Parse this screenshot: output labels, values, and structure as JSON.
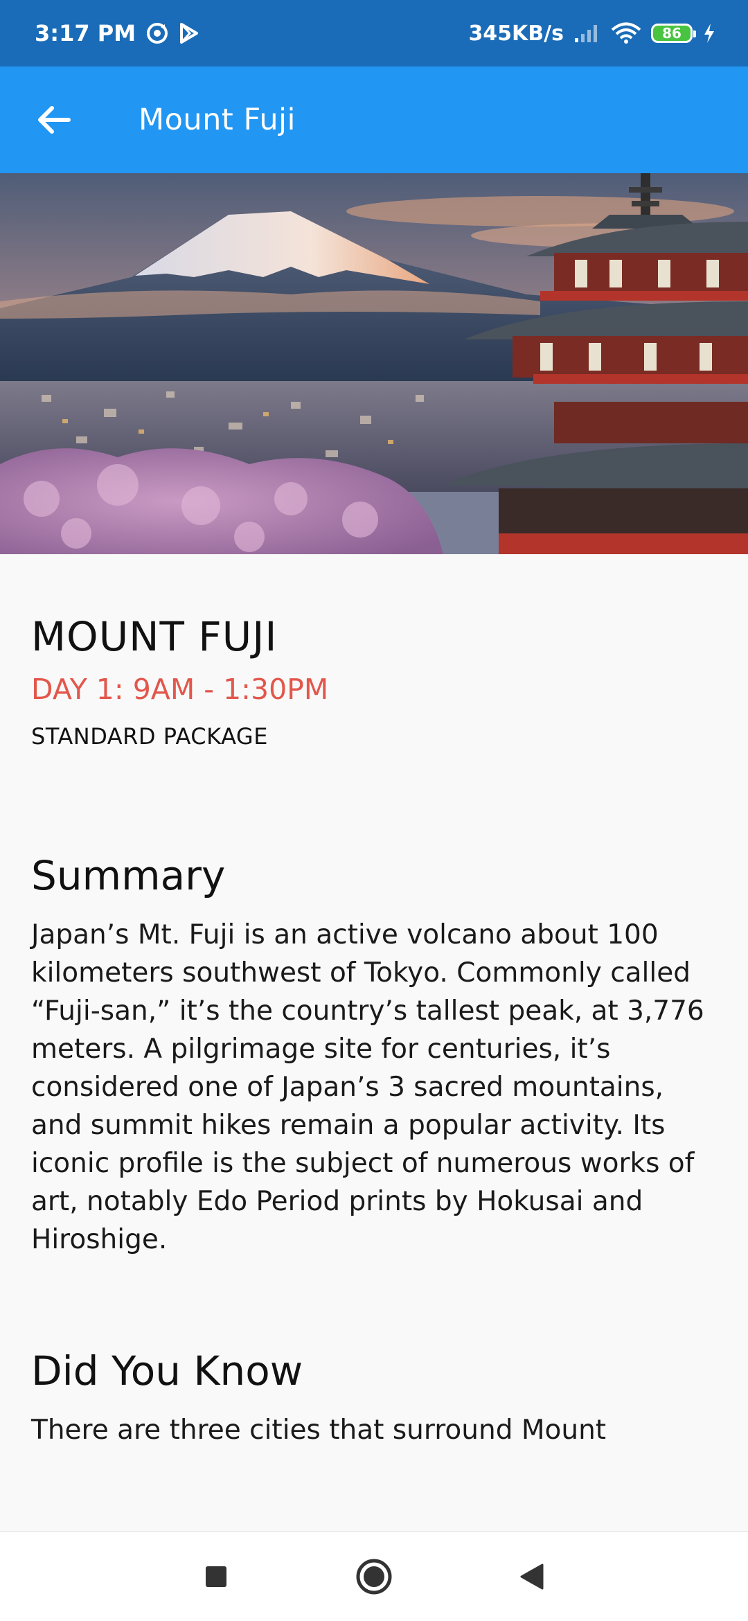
{
  "status_bar": {
    "time": "3:17 PM",
    "network_speed": "345KB/s",
    "battery_level": "86",
    "icons": [
      "sync-icon",
      "play-store-icon",
      "signal-icon",
      "wifi-icon",
      "battery-icon",
      "charging-icon"
    ]
  },
  "app_bar": {
    "title": "Mount Fuji",
    "back_icon": "arrow-left-icon",
    "color": "#2196f3"
  },
  "hero": {
    "description_icon": "mount-fuji-photo"
  },
  "detail": {
    "title": "MOUNT FUJI",
    "schedule": "DAY 1: 9AM - 1:30PM",
    "package": "STANDARD PACKAGE",
    "schedule_color": "#e2574c"
  },
  "summary": {
    "heading": "Summary",
    "text": "Japan’s Mt. Fuji is an active volcano about 100 kilometers southwest of Tokyo. Commonly called “Fuji-san,” it’s the country’s tallest peak, at 3,776 meters. A pilgrimage site for centuries, it’s considered one of Japan’s 3 sacred mountains, and summit hikes remain a popular activity. Its iconic profile is the subject of numerous works of art, notably Edo Period prints by Hokusai and Hiroshige."
  },
  "did_you_know": {
    "heading": "Did You Know",
    "text": "There are three cities that surround Mount"
  },
  "nav_bar": {
    "icons": [
      "recents-square-icon",
      "home-circle-icon",
      "back-triangle-icon"
    ]
  }
}
